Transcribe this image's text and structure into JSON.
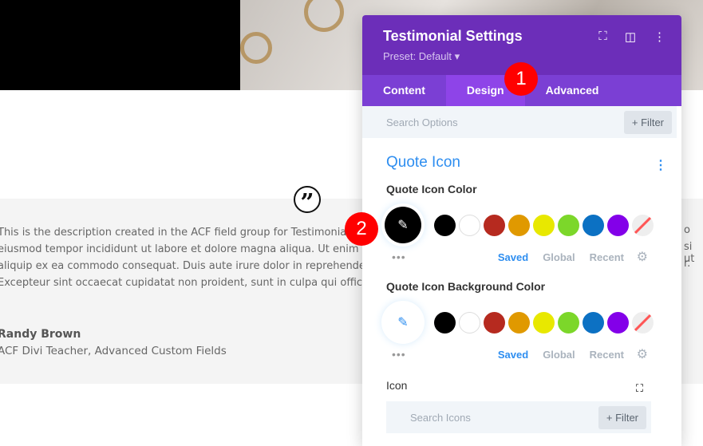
{
  "testimonial": {
    "description_lines": [
      "This is the description created in the ACF field group for Testimonia",
      "eiusmod tempor incididunt ut labore et dolore magna aliqua. Ut enim",
      "aliquip ex ea commodo consequat. Duis aute irure dolor in reprehende",
      "Excepteur sint occaecat cupidatat non proident, sunt in culpa qui offici"
    ],
    "overflow_right": [
      "o",
      "si ut",
      "r."
    ],
    "name": "Randy Brown",
    "role": "ACF Divi Teacher, Advanced Custom Fields",
    "quote_glyph": "”"
  },
  "panel": {
    "title": "Testimonial Settings",
    "preset": "Preset: Default ▾",
    "tabs": [
      "Content",
      "Design",
      "Advanced"
    ],
    "active_tab": "Design",
    "search_placeholder": "Search Options",
    "filter_label": "+ Filter",
    "section_title": "Quote Icon",
    "quote_icon_color_label": "Quote Icon Color",
    "quote_icon_bg_label": "Quote Icon Background Color",
    "palette_tabs": [
      "Saved",
      "Global",
      "Recent"
    ],
    "icon_label": "Icon",
    "icon_search_placeholder": "Search Icons",
    "icon_filter_label": "+ Filter",
    "swatches": [
      "#000000",
      "#ffffff",
      "#b62a1f",
      "#e09900",
      "#e8e800",
      "#7cd72a",
      "#0c71c3",
      "#8300e9"
    ],
    "accent": "#2e8ef0"
  },
  "badges": [
    "1",
    "2"
  ]
}
